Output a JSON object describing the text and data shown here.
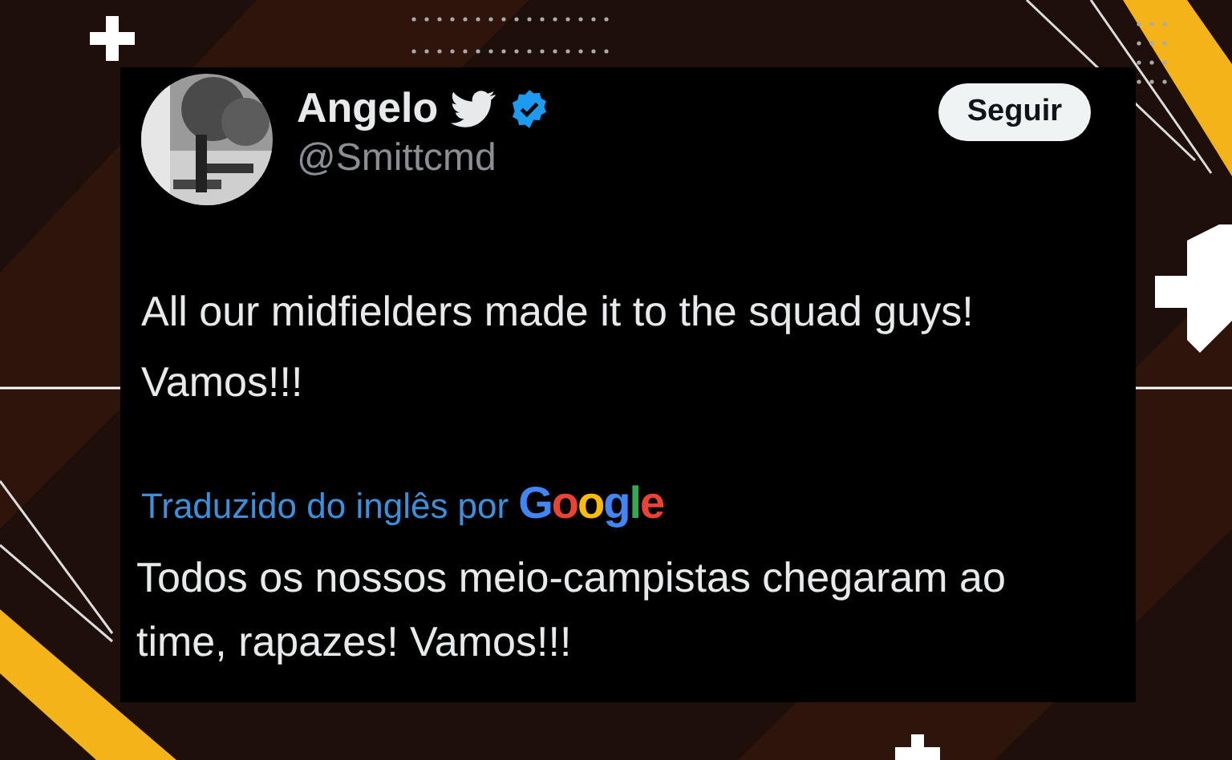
{
  "author": {
    "name": "Angelo",
    "handle": "@Smittcmd",
    "verified": true
  },
  "follow_button": "Seguir",
  "tweet_text": "All our midfielders made it to the squad guys! Vamos!!!",
  "translation": {
    "label": "Traduzido do inglês por",
    "provider": "Google",
    "text": "Todos os nossos meio-campistas chegaram ao time, rapazes! Vamos!!!"
  }
}
